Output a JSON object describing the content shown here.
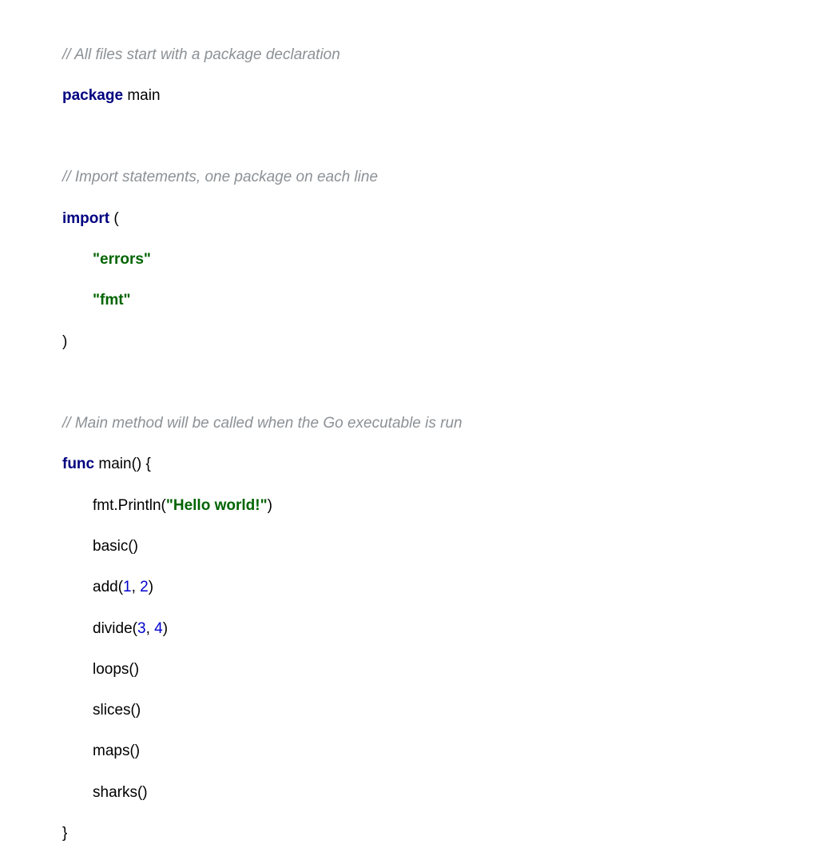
{
  "code": {
    "c1": "// All files start with a package declaration",
    "kw_package": "package",
    "pkg_name": " main",
    "c2": "// Import statements, one package on each line",
    "kw_import": "import",
    "import_open": " (",
    "imp1": "\"errors\"",
    "imp2": "\"fmt\"",
    "import_close": ")",
    "c3": "// Main method will be called when the Go executable is run",
    "kw_func": "func",
    "func_sig": " main() {",
    "l1a": "fmt.Println(",
    "l1b": "\"Hello world!\"",
    "l1c": ")",
    "l2": "basic()",
    "l3a": "add(",
    "l3n1": "1",
    "l3m": ", ",
    "l3n2": "2",
    "l3c": ")",
    "l4a": "divide(",
    "l4n1": "3",
    "l4m": ", ",
    "l4n2": "4",
    "l4c": ")",
    "l5": "loops()",
    "l6": "slices()",
    "l7": "maps()",
    "l8": "sharks()",
    "func_close": "}"
  }
}
